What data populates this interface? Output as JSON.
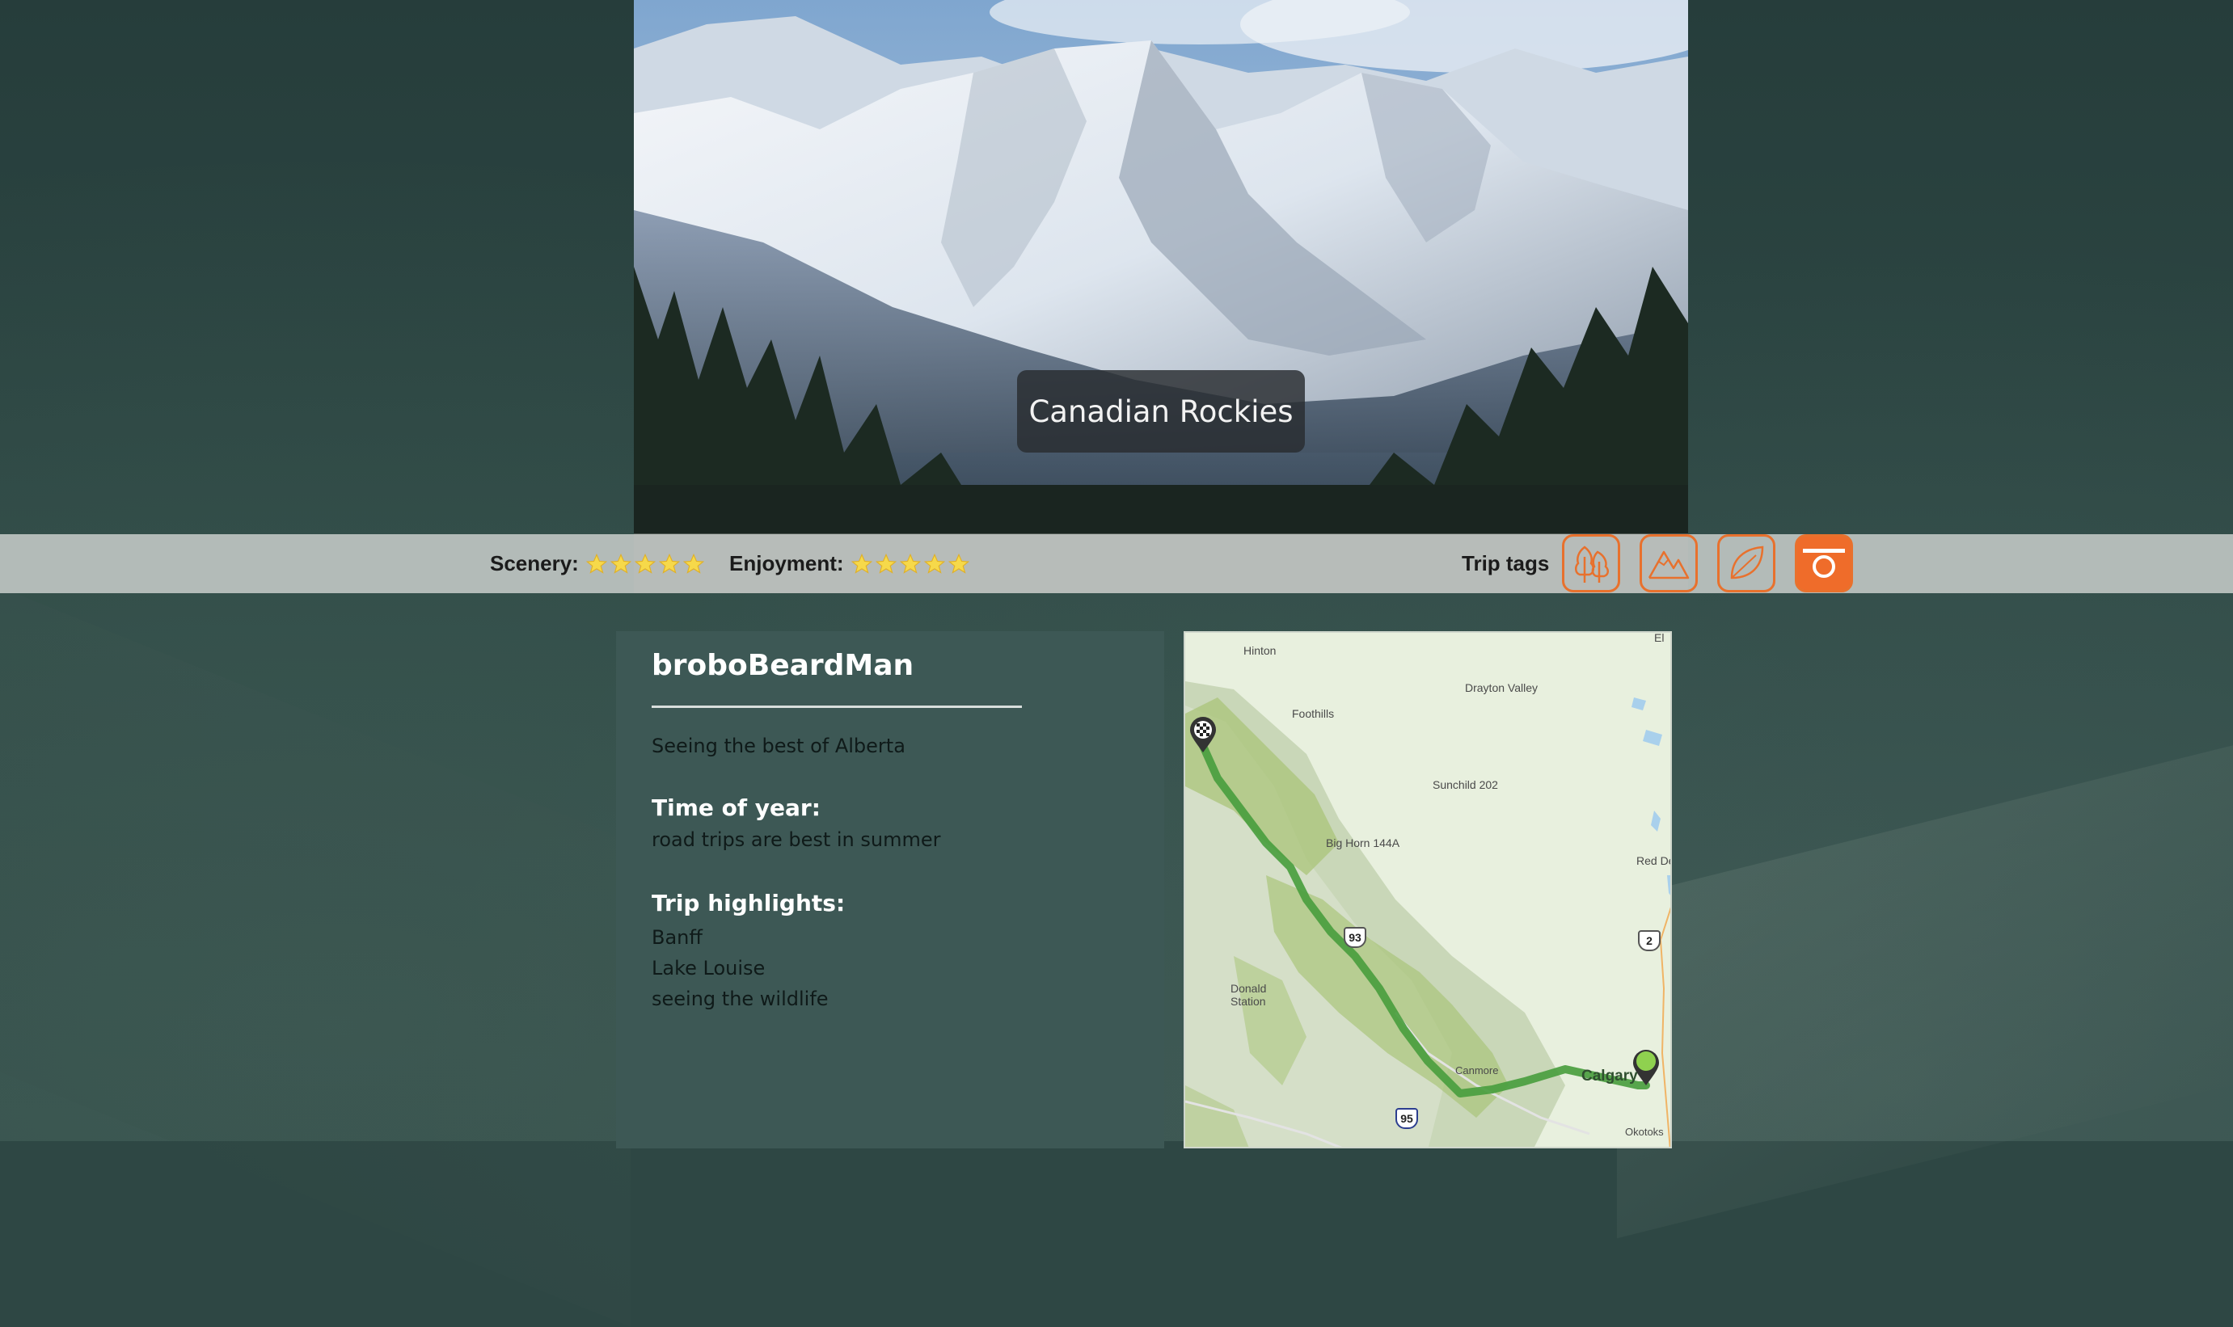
{
  "trip": {
    "title": "Canadian Rockies",
    "author": "broboBeardMan",
    "description": "Seeing the best of Alberta",
    "time_of_year_heading": "Time of year:",
    "time_of_year": "road trips are best in summer",
    "highlights_heading": "Trip highlights:",
    "highlights": [
      "Banff",
      "Lake Louise",
      "seeing the wildlife"
    ]
  },
  "ratings": {
    "scenery_label": "Scenery:",
    "scenery_stars": 5,
    "enjoyment_label": "Enjoyment:",
    "enjoyment_stars": 5
  },
  "tags": {
    "label": "Trip tags",
    "items": [
      {
        "icon": "forest-icon",
        "active": false
      },
      {
        "icon": "mountains-icon",
        "active": false
      },
      {
        "icon": "leaf-icon",
        "active": false
      },
      {
        "icon": "camera-icon",
        "active": true
      }
    ],
    "accent_color": "#ef6c2a"
  },
  "map": {
    "places": {
      "hinton": "Hinton",
      "drayton_valley": "Drayton Valley",
      "foothills": "Foothills",
      "sunchild": "Sunchild 202",
      "big_horn": "Big Horn 144A",
      "red_deer": "Red Dee",
      "donald_station": "Donald\nStation",
      "canmore": "Canmore",
      "calgary": "Calgary",
      "okotoks": "Okotoks",
      "edge_label": "El"
    },
    "shields": {
      "hwy93": "93",
      "hwy2": "2",
      "hwy95": "95"
    },
    "route_color": "#4a9e3f",
    "start_marker": "checkered-flag-pin",
    "end_marker": "green-destination-pin"
  }
}
